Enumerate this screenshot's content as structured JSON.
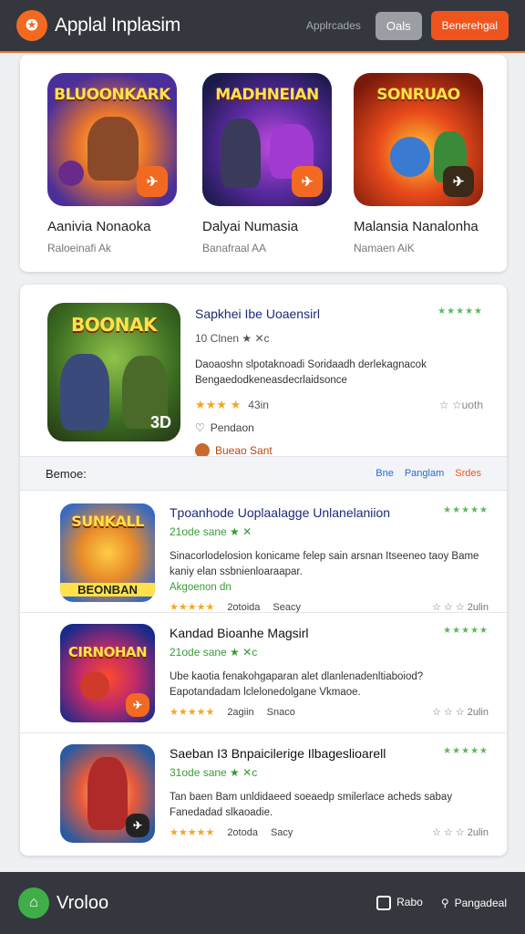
{
  "header": {
    "logo_glyph": "✪",
    "title": "Applal Inplasim",
    "link": "Applrcades",
    "btn_grey": "Oals",
    "btn_orange": "Benerehgal"
  },
  "featured": [
    {
      "tile_title": "BLUOONKARK",
      "name": "Aanivia Nonaoka",
      "sub": "Raloeinafi Ak",
      "badge": "✈"
    },
    {
      "tile_title": "MADHNEIAN",
      "name": "Dalyai Numasia",
      "sub": "Banafraal AA",
      "badge": "✈"
    },
    {
      "tile_title": "SONRUAO",
      "name": "Malansia Nanalonha",
      "sub": "Namaen AiK",
      "badge": "✈"
    }
  ],
  "spotlight": {
    "tile_title": "BOONAK",
    "tile_corner": "3D",
    "title": "Sapkhei Ibe Uoaensirl",
    "rating_stars": "★★★★★",
    "meta": "10 Clnen  ★ ✕c",
    "desc": "Daoaoshn slpotaknoadi Soridaadh derlekagnacok Bengaedodkeneasdecrlaidsonce",
    "user_rating": "★★★ ★",
    "rating_count": "43in",
    "comment_icon": "♡",
    "comment_label": "Pendaon",
    "author": "Bueao Sant",
    "right_label": "☆ ☆uoth"
  },
  "section": {
    "label": "Bemoe:",
    "link1": "Bne",
    "link2": "Panglam",
    "link3": "Srdes"
  },
  "list": [
    {
      "tile_title": "SUNKALL",
      "tile_bottom": "BEONBAN",
      "title": "Tpoanhode Uoplaalagge Unlanelaniion",
      "stars": "★★★★★",
      "meta": "21ode sane ★ ✕",
      "desc": "Sinacorlodelosion konicame felep sain arsnan Itseeneo taoy Bame kaniy elan ssbnienloaraapar.",
      "tag": "Akgoenon dn",
      "rating": "★★★★★",
      "count": "2otoida",
      "extra": "Seacy",
      "right": "☆ ☆ ☆ 2ulin"
    },
    {
      "tile_title": "CIRNOHAN",
      "tile_bottom": "",
      "title": "Kandad Bioanhe Magsirl",
      "stars": "★★★★★",
      "meta": "21ode sane ★ ✕c",
      "desc": "Ube kaotia fenakohgaparan alet dlanlenadenltiaboiod? Eapotandadam lclelonedolgane Vkmaoe.",
      "tag": "",
      "rating": "★★★★★",
      "count": "2agiin",
      "extra": "Snaco",
      "right": "☆ ☆ ☆ 2ulin"
    },
    {
      "tile_title": "",
      "tile_bottom": "",
      "title": "Saeban I3 Bnpaicilerige Ilbageslioarell",
      "stars": "★★★★★",
      "meta": "31ode sane ★ ✕c",
      "desc": "Tan baen Bam unldidaeed soeaedp smilerlace acheds sabay Fanedadad slkaoadie.",
      "tag": "",
      "rating": "★★★★★",
      "count": "2otoda",
      "extra": "Sacy",
      "right": "☆ ☆ ☆ 2ulin"
    }
  ],
  "footer": {
    "logo_glyph": "⌂",
    "title": "Vroloo",
    "link1": "Rabo",
    "link2": "Pangadeal"
  },
  "colors": {
    "brand_orange": "#f0541c",
    "header_bg": "#34373d",
    "accent_green": "#3fae49"
  }
}
